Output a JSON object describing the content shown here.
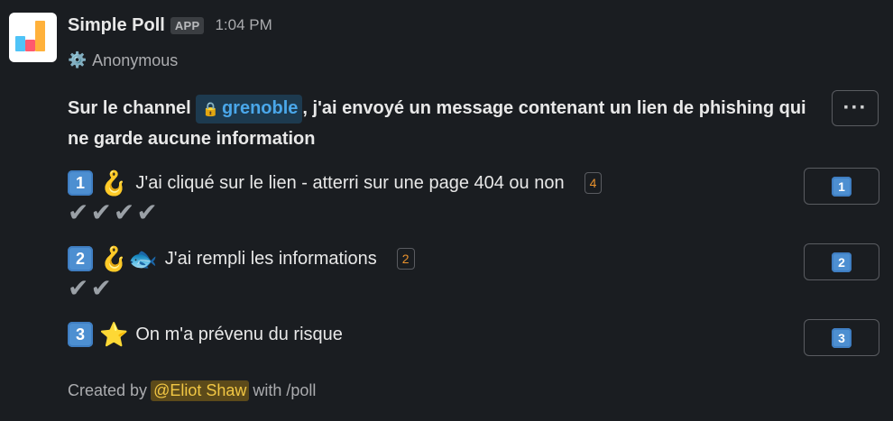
{
  "message": {
    "app_name": "Simple Poll",
    "app_badge": "APP",
    "timestamp": "1:04 PM",
    "subtitle_icon": "gear-icon",
    "subtitle": "Anonymous",
    "more_label": "···"
  },
  "question": {
    "prefix": "Sur le channel ",
    "channel": "grenoble",
    "suffix": ", j'ai envoyé un message contenant un lien de phishing qui ne garde aucune information"
  },
  "options": [
    {
      "number": "1",
      "emojis": "🪝",
      "label": "J'ai cliqué sur le lien - atterri sur une page 404 ou non",
      "count": "4",
      "checks": "✔✔✔✔",
      "button": "1"
    },
    {
      "number": "2",
      "emojis": "🪝🐟",
      "label": "J'ai rempli les informations",
      "count": "2",
      "checks": "✔✔",
      "button": "2"
    },
    {
      "number": "3",
      "emojis": "⭐",
      "label": "On m'a prévenu du risque",
      "button": "3"
    }
  ],
  "footer": {
    "prefix": "Created by",
    "mention": "@Eliot Shaw",
    "suffix": "with /poll"
  },
  "colors": {
    "background": "#1a1d21",
    "channel_text": "#4aa7ea",
    "count_text": "#e8912d",
    "mention_bg": "#5c4a1a",
    "mention_text": "#f2c744",
    "keycap": "#4d8fd1"
  }
}
